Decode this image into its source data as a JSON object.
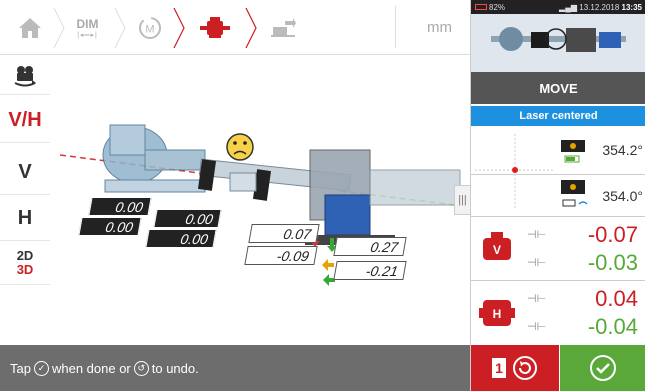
{
  "toolbar": {
    "home_icon": "home-icon",
    "dim_label": "DIM",
    "measure_label": "M",
    "units": "mm"
  },
  "sidebar": {
    "camera_icon": "camera-rotate-icon",
    "vh_label": "V/H",
    "v_label": "V",
    "h_label": "H",
    "label_2d": "2D",
    "label_3d": "3D"
  },
  "view": {
    "stationary_values": {
      "top_left": "0.00",
      "bottom_left": "0.00",
      "top_right": "0.00",
      "bottom_right": "0.00"
    },
    "moveable_values": {
      "v_gap": "0.07",
      "v_offset": "0.27",
      "h_gap": "-0.09",
      "h_offset": "-0.21"
    },
    "tolerance_icon": "sad-face-icon"
  },
  "statusbar": {
    "prefix": "Tap",
    "middle": "when done or",
    "suffix": "to undo."
  },
  "right_panel": {
    "status": {
      "battery": "82%",
      "date": "13.12.2018",
      "time": "13:35"
    },
    "move_label": "MOVE",
    "laser_status": "Laser centered",
    "sensor_angle_1": "354.2°",
    "sensor_angle_2": "354.0°",
    "vertical": {
      "gap": "-0.07",
      "offset": "-0.03"
    },
    "horizontal": {
      "gap": "0.04",
      "offset": "-0.04"
    },
    "undo_count": "1"
  },
  "colors": {
    "accent_red": "#cc1f24",
    "accent_green": "#5aa83a",
    "laser_blue": "#1e90e0",
    "status_gray": "#6d6d6d"
  }
}
